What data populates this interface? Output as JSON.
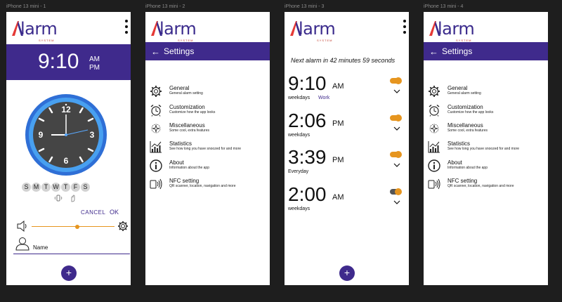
{
  "frames": [
    {
      "label": "iPhone 13 mini - 1"
    },
    {
      "label": "iPhone 13 mini - 2"
    },
    {
      "label": "iPhone 13 mini - 3"
    },
    {
      "label": "iPhone 13 mini - 4"
    }
  ],
  "brand": {
    "logo_text": "lar",
    "logo_text_end": "m",
    "logo_sub": "SYSTEM",
    "accent": "#3f2a8c",
    "logo_mark_color": "#e53935"
  },
  "screen1": {
    "time": "9:10",
    "am": "AM",
    "pm": "PM",
    "clock_numbers": {
      "n12": "12",
      "n3": "3",
      "n6": "6",
      "n9": "9"
    },
    "days": [
      "S",
      "M",
      "T",
      "W",
      "T",
      "F",
      "S"
    ],
    "cancel_label": "CANCEL",
    "ok_label": "OK",
    "volume_level": 0.55,
    "name_label": "Name",
    "fab_label": "+"
  },
  "settings": {
    "title": "Settings",
    "items": [
      {
        "title": "General",
        "subtitle": "General alarm setting",
        "icon": "gear-icon"
      },
      {
        "title": "Customization",
        "subtitle": "Customize how the app looks",
        "icon": "alarm-clock-icon"
      },
      {
        "title": "Miscellaneous",
        "subtitle": "Some cool, extra features",
        "icon": "sparkle-icon"
      },
      {
        "title": "Statistics",
        "subtitle": "See how long you have snoozed for and more",
        "icon": "chart-icon"
      },
      {
        "title": "About",
        "subtitle": "Information about the app",
        "icon": "info-icon"
      },
      {
        "title": "NFC setting",
        "subtitle": "QR scanner, location, navigation and more",
        "icon": "nfc-icon"
      }
    ]
  },
  "screen3": {
    "next_alarm": "Next alarm in 42 minutes 59 seconds",
    "alarms": [
      {
        "time": "9:10",
        "ampm": "AM",
        "repeat": "weekdays",
        "label": "Work",
        "enabled": true
      },
      {
        "time": "2:06",
        "ampm": "PM",
        "repeat": "weekdays",
        "label": "",
        "enabled": true
      },
      {
        "time": "3:39",
        "ampm": "PM",
        "repeat": "Everyday",
        "label": "",
        "enabled": true
      },
      {
        "time": "2:00",
        "ampm": "AM",
        "repeat": "weekdays",
        "label": "",
        "enabled": false
      }
    ],
    "fab_label": "+",
    "toggle_on_color": "#e6951f",
    "toggle_off_color": "#555555"
  }
}
